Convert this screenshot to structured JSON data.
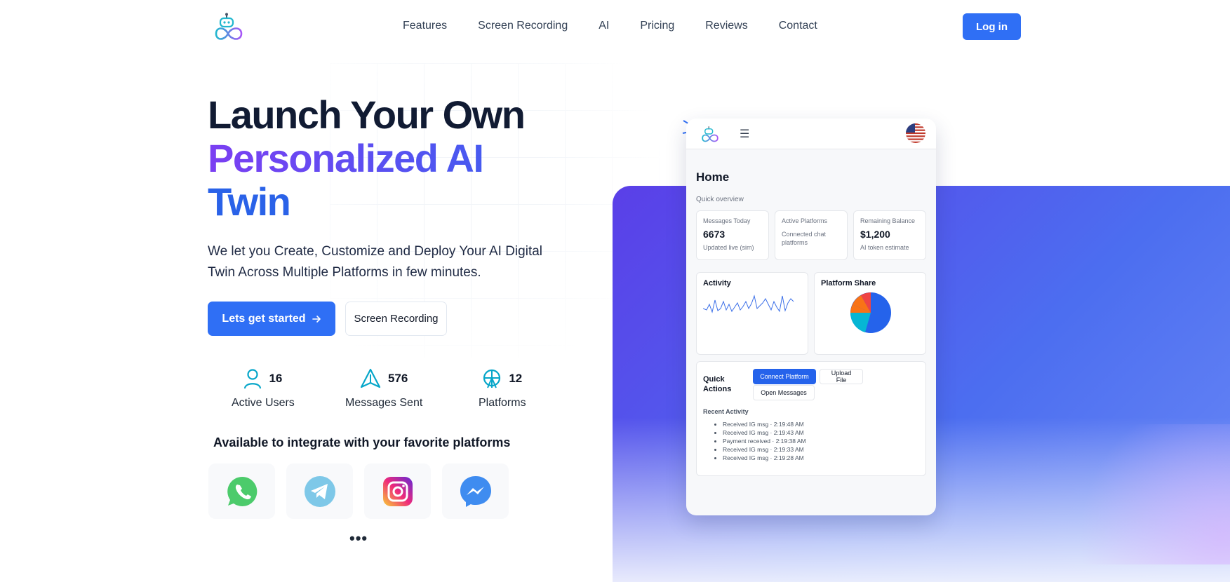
{
  "nav": {
    "links": [
      "Features",
      "Screen Recording",
      "AI",
      "Pricing",
      "Reviews",
      "Contact"
    ],
    "login_label": "Log in"
  },
  "hero": {
    "title_line1": "Launch Your Own",
    "title_line2": "Personalized AI",
    "title_line3": "Twin",
    "subtitle": "We let you Create, Customize and Deploy Your AI Digital Twin Across Multiple Platforms in few minutes.",
    "cta_primary": "Lets get started",
    "cta_secondary": "Screen Recording"
  },
  "stats": [
    {
      "value": "16",
      "label": "Active Users",
      "icon": "user-icon"
    },
    {
      "value": "576",
      "label": "Messages Sent",
      "icon": "paper-plane-icon"
    },
    {
      "value": "12",
      "label": "Platforms",
      "icon": "platforms-icon"
    }
  ],
  "integrations": {
    "title": "Available to integrate with your favorite platforms",
    "platforms": [
      "whatsapp-icon",
      "telegram-icon",
      "instagram-icon",
      "messenger-icon"
    ],
    "more": "•••"
  },
  "dashboard": {
    "title": "Home",
    "subtitle": "Quick overview",
    "kpis": [
      {
        "label": "Messages Today",
        "value": "6673",
        "note": "Updated live (sim)"
      },
      {
        "label": "Active Platforms",
        "value": "",
        "note": "Connected chat platforms"
      },
      {
        "label": "Remaining Balance",
        "value": "$1,200",
        "note": "AI token estimate"
      }
    ],
    "activity_title": "Activity",
    "share_title": "Platform Share",
    "quick_actions_title": "Quick Actions",
    "buttons": {
      "connect": "Connect Platform",
      "upload": "Upload File",
      "open": "Open Messages"
    },
    "recent_title": "Recent Activity",
    "recent": [
      "Received IG msg · 2:19:48 AM",
      "Received IG msg · 2:19:43 AM",
      "Payment received · 2:19:38 AM",
      "Received IG msg · 2:19:33 AM",
      "Received IG msg · 2:19:28 AM"
    ]
  },
  "colors": {
    "accent": "#2f6ff5",
    "title_dark": "#111b33",
    "gradient_start": "#7b3ff2",
    "gradient_end": "#2a62e8"
  }
}
